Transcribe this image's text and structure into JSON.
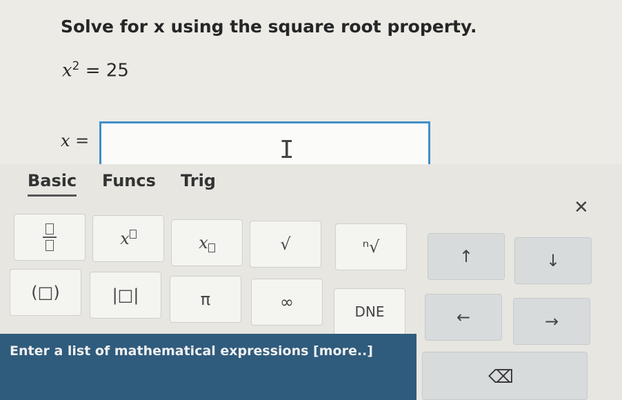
{
  "question": {
    "text": "Solve for x using the square root property."
  },
  "equation": {
    "lhs": "x",
    "exp": "2",
    "rhs": "= 25"
  },
  "answer": {
    "label": "x =",
    "value": ""
  },
  "keypad": {
    "tabs": [
      "Basic",
      "Funcs",
      "Trig"
    ],
    "keys": {
      "fraction": "",
      "power": "x",
      "subscript": "x",
      "sqrt": "√",
      "nthroot": "ⁿ√",
      "up": "↑",
      "down": "↓",
      "paren": "(□)",
      "abs": "|□|",
      "pi": "π",
      "infinity": "∞",
      "dne": "DNE",
      "left": "←",
      "right": "→"
    }
  },
  "footer": {
    "text": "Enter a list of mathematical expressions [more..]"
  },
  "icons": {
    "close": "close-icon",
    "backspace": "backspace-icon",
    "cursor": "text-cursor-icon"
  }
}
